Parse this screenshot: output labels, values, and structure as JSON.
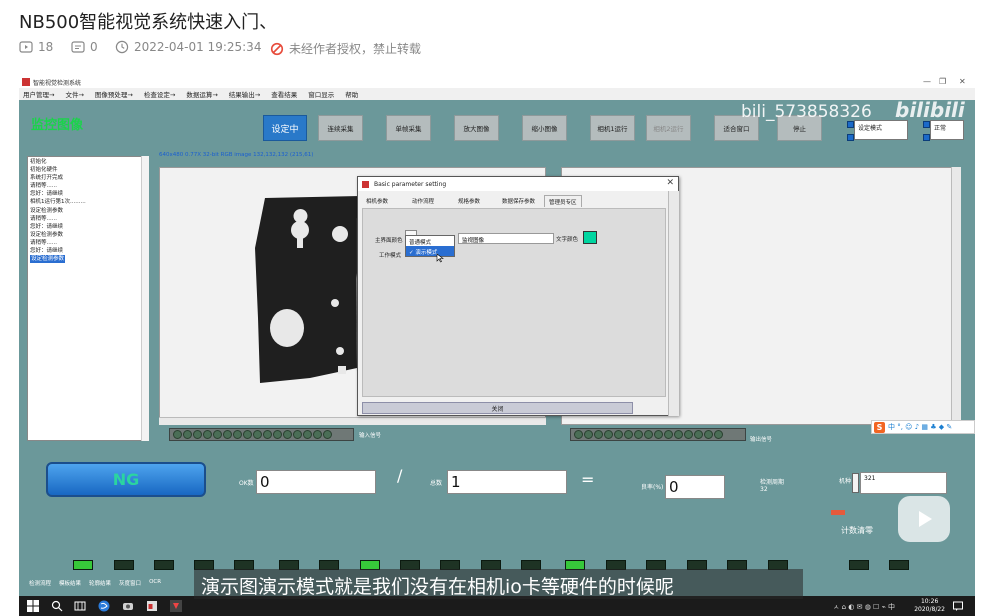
{
  "post": {
    "title": "NB500智能视觉系统快速入门、",
    "plays": "18",
    "comments": "0",
    "datetime": "2022-04-01 19:25:34",
    "notice": "未经作者授权，禁止转载"
  },
  "app": {
    "window_title": "智能视觉检测系统",
    "menu": [
      "用户管理→",
      "文件→",
      "图像预处理→",
      "检查设定→",
      "数据运算→",
      "结果输出→",
      "查看结果",
      "窗口显示",
      "帮助"
    ],
    "brand": "监控图像",
    "toolbar": [
      {
        "label": "设定中",
        "state": "active"
      },
      {
        "label": "连续采集",
        "state": "normal"
      },
      {
        "label": "单帧采集",
        "state": "normal"
      },
      {
        "label": "放大图像",
        "state": "normal"
      },
      {
        "label": "缩小图像",
        "state": "normal"
      },
      {
        "label": "相机1运行",
        "state": "normal"
      },
      {
        "label": "相机2运行",
        "state": "disabled"
      },
      {
        "label": "适合窗口",
        "state": "normal"
      },
      {
        "label": "停止",
        "state": "normal"
      }
    ],
    "status": {
      "mode": "设定模式",
      "state": "正常"
    },
    "watermark": "bili_573858326",
    "watermark_logo": "bilibili",
    "image_info": "640x480 0.77X 32-bit RGB image 132,132,132   (215,61)",
    "log_lines": [
      "初始化",
      "初始化硬件",
      "系统打开完成",
      "请稍等......",
      "您好：请继续",
      "相机1运行第1次.........",
      "设定检测参数",
      "请稍等......",
      "您好：请继续",
      "设定检测参数",
      "请稍等......",
      "您好：请继续"
    ],
    "log_selected": "设定检测参数",
    "led_left_label": "输入信号",
    "led_right_label": "输出信号"
  },
  "dialog": {
    "title": "Basic parameter setting",
    "tabs": [
      "相机参数",
      "动作流程",
      "规格参数",
      "数据保存参数",
      "管理员专区"
    ],
    "active_tab": "管理员专区",
    "label_ui_color": "主界面颜色",
    "label_work_mode": "工作模式",
    "text_value": "监视图像",
    "label_text_color": "文字颜色",
    "dropdown_options": [
      "普通模式",
      "演示模式"
    ],
    "dropdown_selected": "演示模式",
    "checkmark": "✓",
    "close_label": "关闭",
    "text_color": "#00d5a0"
  },
  "bottom": {
    "ng_label": "NG",
    "ok_label": "OK数",
    "ok_value": "0",
    "slash": "/",
    "total_label": "总数",
    "total_value": "1",
    "equals": "=",
    "rate_label": "良率(%)",
    "rate_value": "0",
    "cycle_label": "检测周期",
    "cycle_value": "32",
    "machine_label": "机种",
    "machine_value": "321",
    "reset_label": "计数清零",
    "tabs": [
      "检测流程",
      "模板结果",
      "轮廓结果",
      "灰度窗口",
      "OCR"
    ],
    "led_states": [
      true,
      false,
      false,
      false,
      false,
      false,
      false,
      false,
      true,
      false,
      false,
      false,
      false,
      true,
      false,
      false,
      false,
      false,
      false,
      false
    ]
  },
  "ime": {
    "brand": "S",
    "items": "中 °, ☺ ♪ ▦ ♣ ◆ ✎"
  },
  "subtitle": "演示图演示模式就是我们没有在相机io卡等硬件的时候呢",
  "taskbar": {
    "time": "10:26",
    "date": "2020/8/22",
    "tray": "ㅅ ⌂ ◐ ✉ ◍ ☐ ⌁ 中"
  }
}
